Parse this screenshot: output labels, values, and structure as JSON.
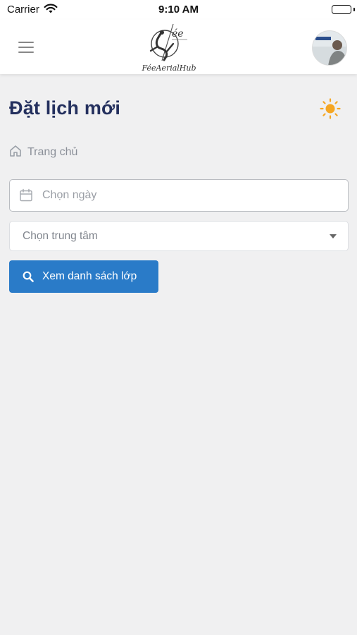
{
  "status_bar": {
    "carrier": "Carrier",
    "time": "9:10 AM"
  },
  "header": {
    "logo_text": "FéeAerialHub",
    "menu_icon": "hamburger-icon",
    "avatar_icon": "user-avatar"
  },
  "page": {
    "title": "Đặt lịch mới",
    "theme_icon": "sun-icon"
  },
  "breadcrumb": {
    "home_icon": "home-icon",
    "label": "Trang chủ"
  },
  "form": {
    "date_placeholder": "Chọn ngày",
    "date_value": "",
    "calendar_icon": "calendar-icon",
    "center_select_value": "Chọn trung tâm",
    "search_button_label": "Xem danh sách lớp",
    "search_icon": "search-icon"
  },
  "colors": {
    "title": "#24305e",
    "primary_button": "#2a7bc8",
    "background": "#f0f0f1",
    "sun": "#f5a623"
  }
}
